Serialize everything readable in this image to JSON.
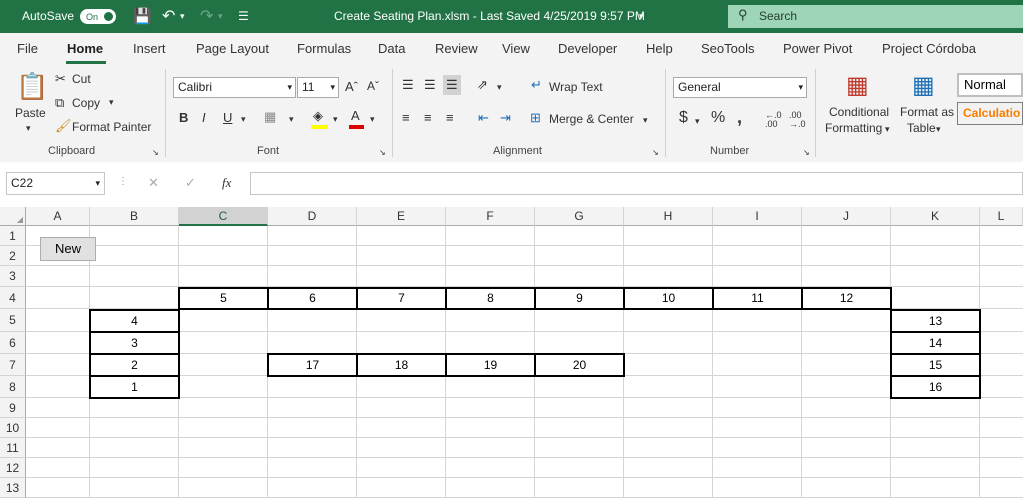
{
  "titlebar": {
    "autosave_label": "AutoSave",
    "autosave_state": "On",
    "file_title": "Create Seating Plan.xlsm  -  Last Saved 4/25/2019 9:57 PM",
    "search_placeholder": "Search",
    "accent_color": "#217346"
  },
  "menu": {
    "tabs": [
      "File",
      "Home",
      "Insert",
      "Page Layout",
      "Formulas",
      "Data",
      "Review",
      "View",
      "Developer",
      "Help",
      "SeoTools",
      "Power Pivot",
      "Project Córdoba"
    ],
    "active_tab": "Home"
  },
  "ribbon": {
    "clipboard": {
      "paste": "Paste",
      "cut": "Cut",
      "copy": "Copy",
      "format_painter": "Format Painter",
      "label": "Clipboard"
    },
    "font": {
      "name": "Calibri",
      "size": "11",
      "label": "Font"
    },
    "alignment": {
      "wrap_text": "Wrap Text",
      "merge_center": "Merge & Center",
      "label": "Alignment"
    },
    "number": {
      "format": "General",
      "label": "Number"
    },
    "styles": {
      "conditional_1": "Conditional",
      "conditional_2": "Formatting",
      "format_table_1": "Format as",
      "format_table_2": "Table",
      "normal": "Normal",
      "calculation": "Calculatio"
    }
  },
  "formula_bar": {
    "name_box": "C22",
    "fx": "fx",
    "value": ""
  },
  "sheet": {
    "columns": [
      "A",
      "B",
      "C",
      "D",
      "E",
      "F",
      "G",
      "H",
      "I",
      "J",
      "K",
      "L"
    ],
    "selected_column": "C",
    "rows": [
      "1",
      "2",
      "3",
      "4",
      "5",
      "6",
      "7",
      "8",
      "9",
      "10",
      "11",
      "12",
      "13"
    ],
    "new_button": "New",
    "seats": {
      "row4": [
        "5",
        "6",
        "7",
        "8",
        "9",
        "10",
        "11",
        "12"
      ],
      "left": [
        "4",
        "3",
        "2",
        "1"
      ],
      "right": [
        "13",
        "14",
        "15",
        "16"
      ],
      "middle": [
        "17",
        "18",
        "19",
        "20"
      ]
    }
  }
}
